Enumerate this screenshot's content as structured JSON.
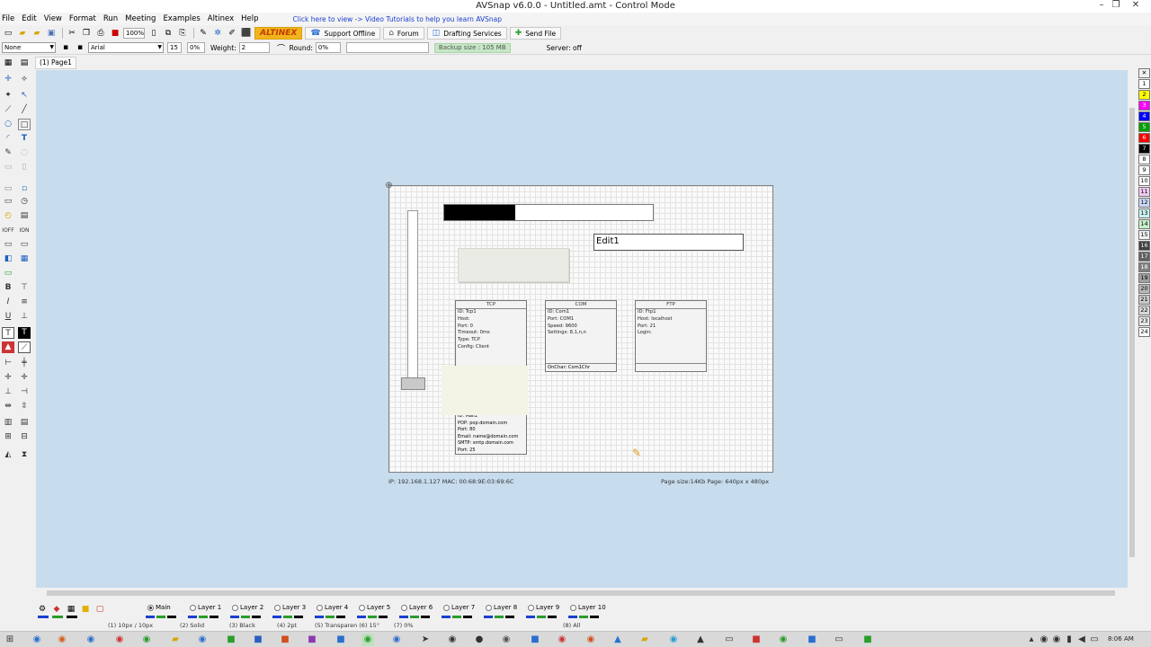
{
  "window": {
    "title": "AVSnap v6.0.0 - Untitled.amt - Control Mode",
    "minimize": "–",
    "maximize": "❐",
    "close": "✕"
  },
  "menu": {
    "items": [
      "File",
      "Edit",
      "View",
      "Format",
      "Run",
      "Meeting",
      "Examples",
      "Altinex",
      "Help"
    ],
    "hint": "Click here to view -> Video Tutorials to help you learn AVSnap"
  },
  "toolbar1": {
    "zoom": "100%",
    "altinex": "ALTINEX",
    "support": "Support Offline",
    "forum": "Forum",
    "drafting": "Drafting Services",
    "send": "Send File"
  },
  "toolbar2": {
    "style": "None",
    "font": "Arial",
    "font_size": "15",
    "percent": "0%",
    "weight_label": "Weight:",
    "weight_value": "2",
    "round_label": "Round:",
    "round_value": "0%",
    "backup": "Backup size : 105 MB",
    "server": "Server: off"
  },
  "tab": {
    "label": "(1) Page1",
    "view_grid": "▦",
    "view_list": "▤"
  },
  "canvas": {
    "edit_label": "Edit1",
    "progress_fill_pct": 34,
    "tcp": {
      "title": "TCP",
      "lines": [
        "ID: Tcp1",
        "Host:",
        "Port: 0",
        "Timeout: 0ms",
        "Type: TCP",
        "Config: Client"
      ]
    },
    "com": {
      "title": "COM",
      "lines": [
        "ID: Com1",
        "Port: COM1",
        "Speed: 9600",
        "Settings: 8,1,n,n"
      ],
      "footer": "OnChar: Com1Chr"
    },
    "ftp": {
      "title": "FTP",
      "lines": [
        "ID: Ftp1",
        "Host: localhost",
        "Port: 21",
        "Login:"
      ]
    },
    "email": {
      "lines": [
        "ID: Mail1",
        "POP: pop.domain.com",
        "Port: 80",
        "Email: name@domain.com",
        "SMTP: smtp.domain.com",
        "Port: 25"
      ]
    },
    "status_left": "IP: 192.168.1.127     MAC: 00:68:9E:03:69:6C",
    "status_right": "Page size:14Kb     Page: 640px x 480px"
  },
  "palette": {
    "swatches": [
      {
        "label": "1",
        "color": "#ffffff"
      },
      {
        "label": "2",
        "color": "#ffff00"
      },
      {
        "label": "3",
        "color": "#ff00ff"
      },
      {
        "label": "4",
        "color": "#0000ff"
      },
      {
        "label": "5",
        "color": "#00a000"
      },
      {
        "label": "6",
        "color": "#ff0000"
      },
      {
        "label": "7",
        "color": "#000000"
      },
      {
        "label": "8",
        "color": "#ffffff"
      },
      {
        "label": "9",
        "color": "#ffffff"
      },
      {
        "label": "10",
        "color": "#ffffff"
      },
      {
        "label": "11",
        "color": "#f0c8f0"
      },
      {
        "label": "12",
        "color": "#c8d8f8"
      },
      {
        "label": "13",
        "color": "#c8f0f0"
      },
      {
        "label": "14",
        "color": "#c8f0c8"
      },
      {
        "label": "15",
        "color": "#f0f0f0"
      },
      {
        "label": "16",
        "color": "#404040"
      },
      {
        "label": "17",
        "color": "#606060"
      },
      {
        "label": "18",
        "color": "#808080"
      },
      {
        "label": "19",
        "color": "#a0a0a0"
      },
      {
        "label": "20",
        "color": "#b8b8b8"
      },
      {
        "label": "21",
        "color": "#c8c8c8"
      },
      {
        "label": "22",
        "color": "#d8d8d8"
      },
      {
        "label": "23",
        "color": "#e8e8e8"
      },
      {
        "label": "24",
        "color": "#ffffff"
      }
    ]
  },
  "layers": {
    "items": [
      "Main",
      "Layer 1",
      "Layer 2",
      "Layer 3",
      "Layer 4",
      "Layer 5",
      "Layer 6",
      "Layer 7",
      "Layer 8",
      "Layer 9",
      "Layer 10"
    ],
    "selected": "Main",
    "footer": [
      "(1) 10px / 10px",
      "(2) Solid",
      "(3) Black",
      "(4) 2pt",
      "(5) Transparen (6) 15°",
      "(7) 0%",
      "(8) All"
    ]
  },
  "taskbar": {
    "clock": "8:06 AM"
  }
}
